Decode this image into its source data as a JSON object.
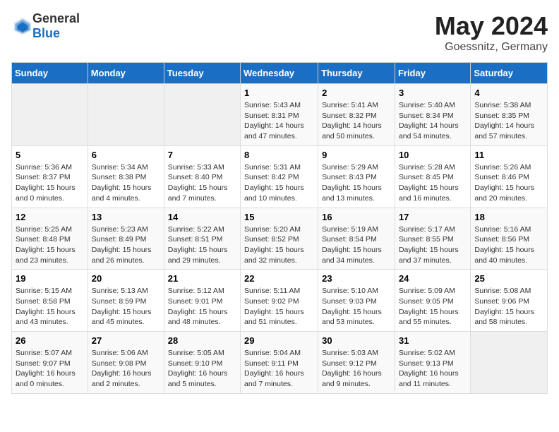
{
  "logo": {
    "text_general": "General",
    "text_blue": "Blue"
  },
  "title": "May 2024",
  "subtitle": "Goessnitz, Germany",
  "weekdays": [
    "Sunday",
    "Monday",
    "Tuesday",
    "Wednesday",
    "Thursday",
    "Friday",
    "Saturday"
  ],
  "weeks": [
    [
      {
        "day": "",
        "info": ""
      },
      {
        "day": "",
        "info": ""
      },
      {
        "day": "",
        "info": ""
      },
      {
        "day": "1",
        "info": "Sunrise: 5:43 AM\nSunset: 8:31 PM\nDaylight: 14 hours\nand 47 minutes."
      },
      {
        "day": "2",
        "info": "Sunrise: 5:41 AM\nSunset: 8:32 PM\nDaylight: 14 hours\nand 50 minutes."
      },
      {
        "day": "3",
        "info": "Sunrise: 5:40 AM\nSunset: 8:34 PM\nDaylight: 14 hours\nand 54 minutes."
      },
      {
        "day": "4",
        "info": "Sunrise: 5:38 AM\nSunset: 8:35 PM\nDaylight: 14 hours\nand 57 minutes."
      }
    ],
    [
      {
        "day": "5",
        "info": "Sunrise: 5:36 AM\nSunset: 8:37 PM\nDaylight: 15 hours\nand 0 minutes."
      },
      {
        "day": "6",
        "info": "Sunrise: 5:34 AM\nSunset: 8:38 PM\nDaylight: 15 hours\nand 4 minutes."
      },
      {
        "day": "7",
        "info": "Sunrise: 5:33 AM\nSunset: 8:40 PM\nDaylight: 15 hours\nand 7 minutes."
      },
      {
        "day": "8",
        "info": "Sunrise: 5:31 AM\nSunset: 8:42 PM\nDaylight: 15 hours\nand 10 minutes."
      },
      {
        "day": "9",
        "info": "Sunrise: 5:29 AM\nSunset: 8:43 PM\nDaylight: 15 hours\nand 13 minutes."
      },
      {
        "day": "10",
        "info": "Sunrise: 5:28 AM\nSunset: 8:45 PM\nDaylight: 15 hours\nand 16 minutes."
      },
      {
        "day": "11",
        "info": "Sunrise: 5:26 AM\nSunset: 8:46 PM\nDaylight: 15 hours\nand 20 minutes."
      }
    ],
    [
      {
        "day": "12",
        "info": "Sunrise: 5:25 AM\nSunset: 8:48 PM\nDaylight: 15 hours\nand 23 minutes."
      },
      {
        "day": "13",
        "info": "Sunrise: 5:23 AM\nSunset: 8:49 PM\nDaylight: 15 hours\nand 26 minutes."
      },
      {
        "day": "14",
        "info": "Sunrise: 5:22 AM\nSunset: 8:51 PM\nDaylight: 15 hours\nand 29 minutes."
      },
      {
        "day": "15",
        "info": "Sunrise: 5:20 AM\nSunset: 8:52 PM\nDaylight: 15 hours\nand 32 minutes."
      },
      {
        "day": "16",
        "info": "Sunrise: 5:19 AM\nSunset: 8:54 PM\nDaylight: 15 hours\nand 34 minutes."
      },
      {
        "day": "17",
        "info": "Sunrise: 5:17 AM\nSunset: 8:55 PM\nDaylight: 15 hours\nand 37 minutes."
      },
      {
        "day": "18",
        "info": "Sunrise: 5:16 AM\nSunset: 8:56 PM\nDaylight: 15 hours\nand 40 minutes."
      }
    ],
    [
      {
        "day": "19",
        "info": "Sunrise: 5:15 AM\nSunset: 8:58 PM\nDaylight: 15 hours\nand 43 minutes."
      },
      {
        "day": "20",
        "info": "Sunrise: 5:13 AM\nSunset: 8:59 PM\nDaylight: 15 hours\nand 45 minutes."
      },
      {
        "day": "21",
        "info": "Sunrise: 5:12 AM\nSunset: 9:01 PM\nDaylight: 15 hours\nand 48 minutes."
      },
      {
        "day": "22",
        "info": "Sunrise: 5:11 AM\nSunset: 9:02 PM\nDaylight: 15 hours\nand 51 minutes."
      },
      {
        "day": "23",
        "info": "Sunrise: 5:10 AM\nSunset: 9:03 PM\nDaylight: 15 hours\nand 53 minutes."
      },
      {
        "day": "24",
        "info": "Sunrise: 5:09 AM\nSunset: 9:05 PM\nDaylight: 15 hours\nand 55 minutes."
      },
      {
        "day": "25",
        "info": "Sunrise: 5:08 AM\nSunset: 9:06 PM\nDaylight: 15 hours\nand 58 minutes."
      }
    ],
    [
      {
        "day": "26",
        "info": "Sunrise: 5:07 AM\nSunset: 9:07 PM\nDaylight: 16 hours\nand 0 minutes."
      },
      {
        "day": "27",
        "info": "Sunrise: 5:06 AM\nSunset: 9:08 PM\nDaylight: 16 hours\nand 2 minutes."
      },
      {
        "day": "28",
        "info": "Sunrise: 5:05 AM\nSunset: 9:10 PM\nDaylight: 16 hours\nand 5 minutes."
      },
      {
        "day": "29",
        "info": "Sunrise: 5:04 AM\nSunset: 9:11 PM\nDaylight: 16 hours\nand 7 minutes."
      },
      {
        "day": "30",
        "info": "Sunrise: 5:03 AM\nSunset: 9:12 PM\nDaylight: 16 hours\nand 9 minutes."
      },
      {
        "day": "31",
        "info": "Sunrise: 5:02 AM\nSunset: 9:13 PM\nDaylight: 16 hours\nand 11 minutes."
      },
      {
        "day": "",
        "info": ""
      }
    ]
  ]
}
